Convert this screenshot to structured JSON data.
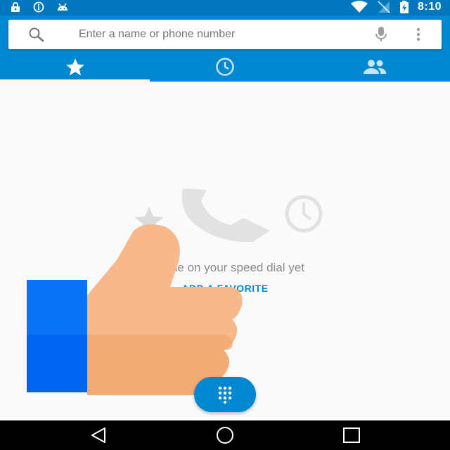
{
  "status_bar": {
    "time": "8:10",
    "icons": [
      "lock-icon",
      "info-icon",
      "android-icon",
      "wifi-icon",
      "no-signal-icon",
      "battery-charging-icon"
    ]
  },
  "search": {
    "placeholder": "Enter a name or phone number",
    "value": ""
  },
  "tabs": [
    {
      "icon": "star-icon",
      "selected": true
    },
    {
      "icon": "recents-clock-icon",
      "selected": false
    },
    {
      "icon": "contacts-icon",
      "selected": false
    }
  ],
  "empty_state": {
    "message": "No one on your speed dial yet",
    "action_label": "ADD A FAVORITE"
  },
  "fab": {
    "icon": "dialpad-icon"
  },
  "nav_bar": {
    "icons": [
      "back-icon",
      "home-icon",
      "recents-icon"
    ]
  },
  "colors": {
    "status_bar": "#0277bd",
    "app_bar": "#0288d1",
    "accent": "#0288d1",
    "background": "#fafafa"
  }
}
